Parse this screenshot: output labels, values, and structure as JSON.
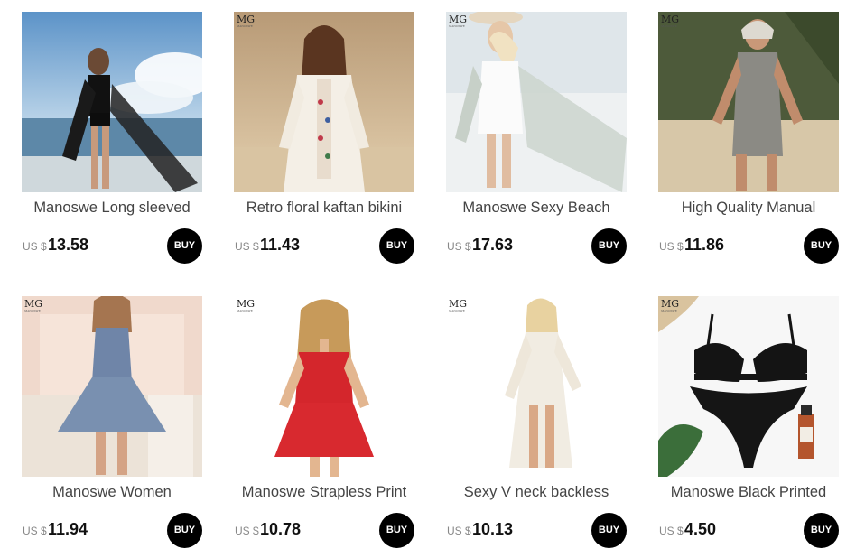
{
  "products": [
    {
      "title": "Manoswe Long sleeved",
      "currency": "US $",
      "price": "13.58",
      "buy_label": "BUY",
      "brand_logo": false
    },
    {
      "title": "Retro floral kaftan bikini",
      "currency": "US $",
      "price": "11.43",
      "buy_label": "BUY",
      "brand_logo": true
    },
    {
      "title": "Manoswe Sexy Beach",
      "currency": "US $",
      "price": "17.63",
      "buy_label": "BUY",
      "brand_logo": true
    },
    {
      "title": "High Quality Manual",
      "currency": "US $",
      "price": "11.86",
      "buy_label": "BUY",
      "brand_logo": true
    },
    {
      "title": "Manoswe Women",
      "currency": "US $",
      "price": "11.94",
      "buy_label": "BUY",
      "brand_logo": true
    },
    {
      "title": "Manoswe Strapless Print",
      "currency": "US $",
      "price": "10.78",
      "buy_label": "BUY",
      "brand_logo": true
    },
    {
      "title": "Sexy V neck backless",
      "currency": "US $",
      "price": "10.13",
      "buy_label": "BUY",
      "brand_logo": true
    },
    {
      "title": "Manoswe Black Printed",
      "currency": "US $",
      "price": "4.50",
      "buy_label": "BUY",
      "brand_logo": true
    }
  ],
  "brand_logo_text": "MG",
  "brand_logo_subtext": "MANOSWE",
  "colors": {
    "buy_button": "#000000",
    "price_text": "#111111",
    "title_text": "#444444",
    "currency_text": "#888888"
  }
}
